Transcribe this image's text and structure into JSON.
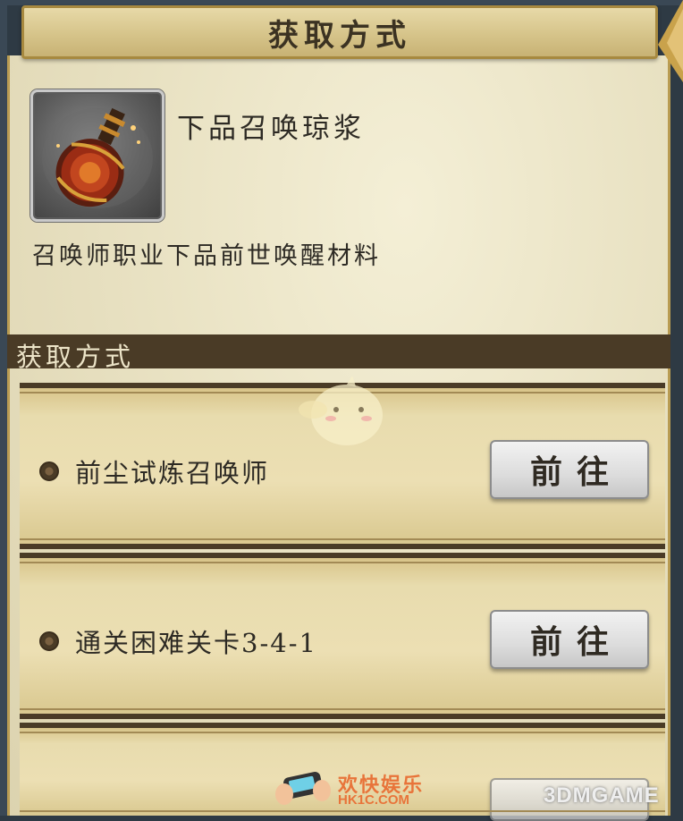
{
  "header": {
    "title": "获取方式"
  },
  "item": {
    "name": "下品召唤琼浆",
    "icon": "elixir-flask-icon",
    "description": "召唤师职业下品前世唤醒材料"
  },
  "section": {
    "title": "获取方式"
  },
  "sources": [
    {
      "label": "前尘试炼召唤师",
      "button_label": "前往"
    },
    {
      "label": "通关困难关卡3-4-1",
      "button_label": "前往"
    }
  ],
  "watermark": {
    "site_cn": "欢快娱乐",
    "site_url": "HK1C.COM",
    "brand": "3DMGAME"
  },
  "colors": {
    "panel": "#e9e2c3",
    "section_bar": "#4a3b26",
    "text": "#2d2a24",
    "watermark_orange": "#e8743a"
  }
}
